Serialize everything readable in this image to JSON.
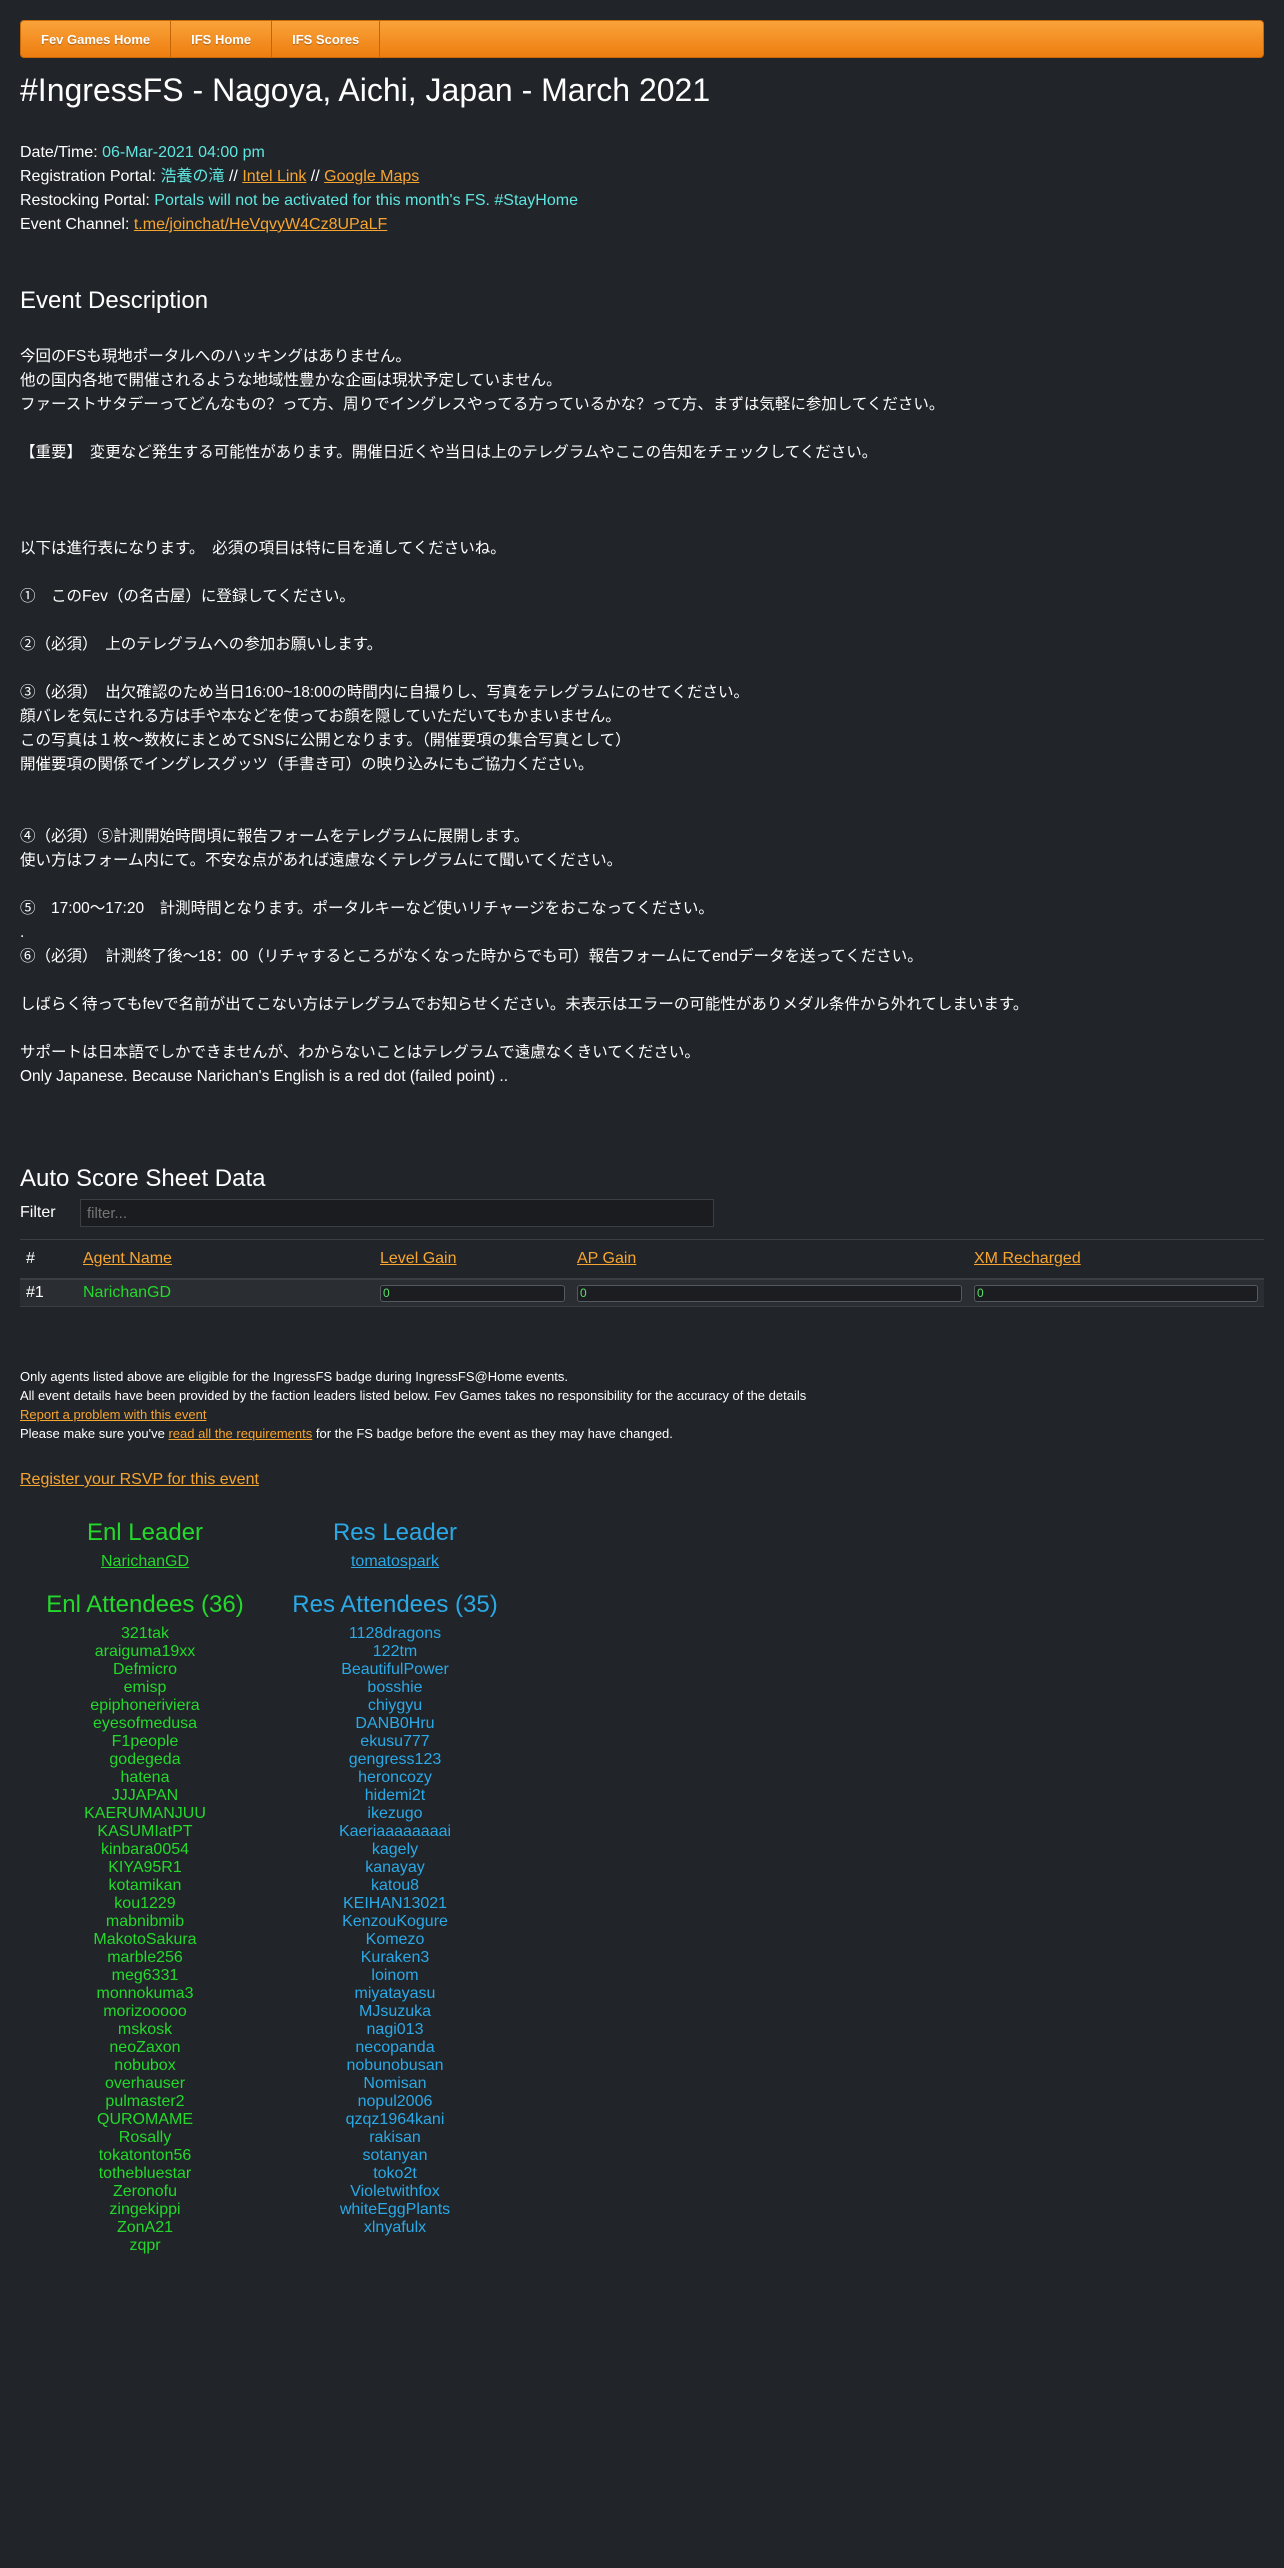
{
  "nav": [
    "Fev Games Home",
    "IFS Home",
    "IFS Scores"
  ],
  "title": "#IngressFS - Nagoya, Aichi, Japan - March 2021",
  "info": {
    "datetime_label": "Date/Time:",
    "datetime_value": "06-Mar-2021 04:00 pm",
    "reg_label": "Registration Portal:",
    "reg_value": "浩養の滝",
    "reg_sep1": " // ",
    "intel_link": "Intel Link",
    "reg_sep2": " // ",
    "maps_link": "Google Maps",
    "restock_label": "Restocking Portal:",
    "restock_value": "Portals will not be activated for this month's FS. #StayHome",
    "channel_label": "Event Channel:",
    "channel_link": "t.me/joinchat/HeVqvyW4Cz8UPaLF"
  },
  "event_description": {
    "heading": "Event Description",
    "lines": [
      "今回のFSも現地ポータルへのハッキングはありません。",
      "他の国内各地で開催されるような地域性豊かな企画は現状予定していません。",
      "ファーストサタデーってどんなもの？って方、周りでイングレスやってる方っているかな？って方、まずは気軽に参加してください。",
      "",
      "【重要】　変更など発生する可能性があります。開催日近くや当日は上のテレグラムやここの告知をチェックしてください。",
      "",
      "",
      "",
      "以下は進行表になります。　必須の項目は特に目を通してくださいね。",
      "",
      "①　このFev（の名古屋）に登録してください。",
      "",
      "②（必須）　上のテレグラムへの参加お願いします。",
      "",
      "③（必須）　出欠確認のため当日16:00~18:00の時間内に自撮りし、写真をテレグラムにのせてください。",
      "顔バレを気にされる方は手や本などを使ってお顔を隠していただいてもかまいません。",
      "この写真は１枚～数枚にまとめてSNSに公開となります。（開催要項の集合写真として）",
      "開催要項の関係でイングレスグッツ（手書き可）の映り込みにもご協力ください。",
      "",
      "",
      "④（必須）⑤計測開始時間頃に報告フォームをテレグラムに展開します。",
      "使い方はフォーム内にて。不安な点があれば遠慮なくテレグラムにて聞いてください。",
      "",
      "⑤　17:00～17:20　計測時間となります。ポータルキーなど使いリチャージをおこなってください。",
      ".",
      "⑥（必須）　計測終了後～18：00（リチャするところがなくなった時からでも可）報告フォームにてendデータを送ってください。",
      "",
      "しばらく待ってもfevで名前が出てこない方はテレグラムでお知らせください。未表示はエラーの可能性がありメダル条件から外れてしまいます。",
      "",
      "サポートは日本語でしかできませんが、わからないことはテレグラムで遠慮なくきいてください。",
      "Only Japanese. Because Narichan's English is a red dot (failed point) .."
    ]
  },
  "score_sheet": {
    "heading": "Auto Score Sheet Data",
    "filter_label": "Filter",
    "filter_placeholder": "filter...",
    "columns": [
      "#",
      "Agent Name",
      "Level Gain",
      "AP Gain",
      "XM Recharged"
    ],
    "rows": [
      {
        "rank": "#1",
        "agent": "NarichanGD",
        "level_gain": "0",
        "ap_gain": "0",
        "xm": "0"
      }
    ]
  },
  "notes": {
    "line1": "Only agents listed above are eligible for the IngressFS badge during IngressFS@Home events.",
    "line2": "All event details have been provided by the faction leaders listed below. Fev Games takes no responsibility for the accuracy of the details",
    "report_link": "Report a problem with this event",
    "line4_pre": "Please make sure you've ",
    "line4_link": "read all the requirements",
    "line4_post": " for the FS badge before the event as they may have changed.",
    "rsvp": "Register your RSVP for this event"
  },
  "enl": {
    "leader_heading": "Enl Leader",
    "leader": "NarichanGD",
    "attendees_heading": "Enl Attendees (36)",
    "attendees": [
      "321tak",
      "araiguma19xx",
      "Defmicro",
      "emisp",
      "epiphoneriviera",
      "eyesofmedusa",
      "F1people",
      "godegeda",
      "hatena",
      "JJJAPAN",
      "KAERUMANJUU",
      "KASUMIatPT",
      "kinbara0054",
      "KIYA95R1",
      "kotamikan",
      "kou1229",
      "mabnibmib",
      "MakotoSakura",
      "marble256",
      "meg6331",
      "monnokuma3",
      "morizooooo",
      "mskosk",
      "neoZaxon",
      "nobubox",
      "overhauser",
      "pulmaster2",
      "QUROMAME",
      "Rosally",
      "tokatonton56",
      "tothebluestar",
      "Zeronofu",
      "zingekippi",
      "ZonA21",
      "zqpr"
    ],
    "color": "#24d92c"
  },
  "res": {
    "leader_heading": "Res Leader",
    "leader": "tomatospark",
    "attendees_heading": "Res Attendees (35)",
    "attendees": [
      "1128dragons",
      "122tm",
      "BeautifulPower",
      "bosshie",
      "chiygyu",
      "DANB0Hru",
      "ekusu777",
      "gengress123",
      "heroncozy",
      "hidemi2t",
      "ikezugo",
      "Kaeriaaaaaaaai",
      "kagely",
      "kanayay",
      "katou8",
      "KEIHAN13021",
      "KenzouKogure",
      "Komezo",
      "Kuraken3",
      "loinom",
      "miyatayasu",
      "MJsuzuka",
      "nagi013",
      "necopanda",
      "nobunobusan",
      "Nomisan",
      "nopul2006",
      "qzqz1964kani",
      "rakisan",
      "sotanyan",
      "toko2t",
      "Violetwithfox",
      "whiteEggPlants",
      "xlnyafulx"
    ],
    "color": "#2ba9e6"
  }
}
